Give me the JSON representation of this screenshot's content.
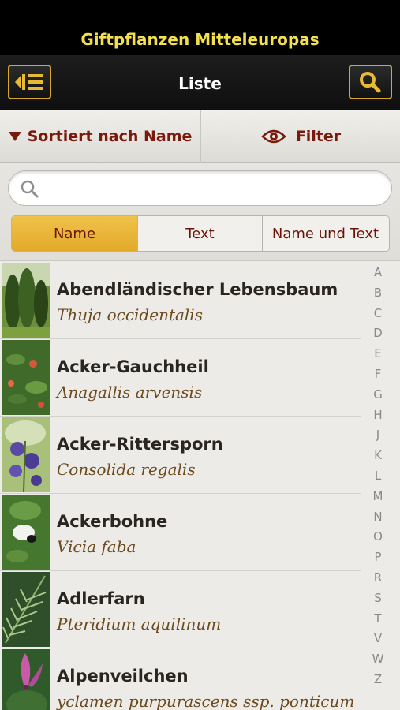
{
  "app": {
    "title": "Giftpflanzen Mitteleuropas"
  },
  "nav": {
    "title": "Liste",
    "menu_icon": "list-menu-icon",
    "search_icon": "search-icon"
  },
  "sortbar": {
    "sort_label": "Sortiert nach Name",
    "filter_label": "Filter"
  },
  "search": {
    "value": "",
    "placeholder": ""
  },
  "segments": [
    {
      "label": "Name",
      "active": true
    },
    {
      "label": "Text",
      "active": false
    },
    {
      "label": "Name und Text",
      "active": false
    }
  ],
  "plants": [
    {
      "name": "Abendländischer Lebensbaum",
      "latin": "Thuja occidentalis",
      "thumb": "thuja"
    },
    {
      "name": "Acker-Gauchheil",
      "latin": "Anagallis arvensis",
      "thumb": "anagallis"
    },
    {
      "name": "Acker-Rittersporn",
      "latin": "Consolida regalis",
      "thumb": "consolida"
    },
    {
      "name": "Ackerbohne",
      "latin": "Vicia faba",
      "thumb": "vicia"
    },
    {
      "name": "Adlerfarn",
      "latin": "Pteridium aquilinum",
      "thumb": "pteridium"
    },
    {
      "name": "Alpenveilchen",
      "latin": "yclamen purpurascens ssp. ponticum",
      "thumb": "cyclamen"
    }
  ],
  "index": [
    "A",
    "B",
    "C",
    "D",
    "E",
    "F",
    "G",
    "H",
    "J",
    "K",
    "L",
    "M",
    "N",
    "O",
    "P",
    "R",
    "S",
    "T",
    "V",
    "W",
    "Z"
  ],
  "colors": {
    "title": "#f3e04e",
    "accent": "#d6a72b",
    "active_segment": "#e8b43a",
    "label_red": "#7a1a0c"
  }
}
